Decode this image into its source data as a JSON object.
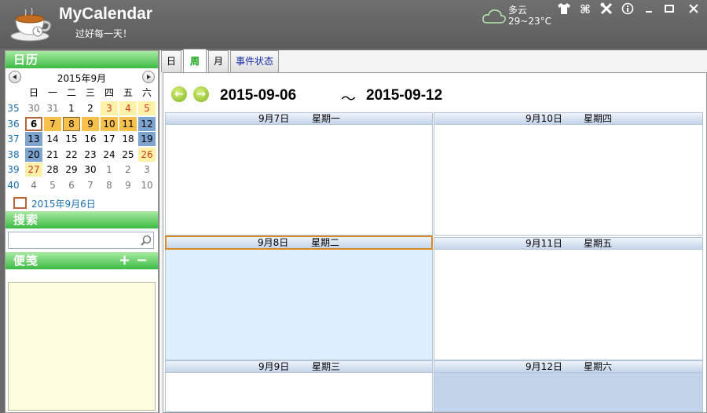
{
  "app": {
    "title": "MyCalendar",
    "subtitle": "过好每一天！",
    "weather": {
      "desc": "多云",
      "temp": "29~23°C"
    }
  },
  "toolbar": {
    "icons": [
      "shirt-icon",
      "command-icon",
      "tools-icon",
      "info-icon",
      "minimize-icon",
      "maximize-icon",
      "close-icon"
    ]
  },
  "calendar": {
    "header": "日历",
    "month_label": "2015年9月",
    "dow": [
      "日",
      "一",
      "二",
      "三",
      "四",
      "五",
      "六"
    ],
    "weeks": [
      "35",
      "36",
      "37",
      "38",
      "39",
      "40"
    ],
    "days": [
      [
        "30",
        "31",
        "1",
        "2",
        "3",
        "4",
        "5"
      ],
      [
        "6",
        "7",
        "8",
        "9",
        "10",
        "11",
        "12"
      ],
      [
        "13",
        "14",
        "15",
        "16",
        "17",
        "18",
        "19"
      ],
      [
        "20",
        "21",
        "22",
        "23",
        "24",
        "25",
        "26"
      ],
      [
        "27",
        "28",
        "29",
        "30",
        "1",
        "2",
        "3"
      ],
      [
        "4",
        "5",
        "6",
        "7",
        "8",
        "9",
        "10"
      ]
    ],
    "today_text": "2015年9月6日"
  },
  "search": {
    "header": "搜索",
    "placeholder": ""
  },
  "memo": {
    "header": "便笺",
    "add": "+",
    "remove": "−"
  },
  "tabs": [
    "日",
    "周",
    "月",
    "事件状态"
  ],
  "week_view": {
    "start": "2015-09-06",
    "sep": "～",
    "end": "2015-09-12",
    "days": [
      {
        "date": "9月7日",
        "weekday": "星期一"
      },
      {
        "date": "9月8日",
        "weekday": "星期二"
      },
      {
        "date": "9月9日",
        "weekday": "星期三"
      },
      {
        "date": "9月10日",
        "weekday": "星期四"
      },
      {
        "date": "9月11日",
        "weekday": "星期五"
      },
      {
        "date": "9月12日",
        "weekday": "星期六"
      }
    ]
  },
  "colors": {
    "green_header": "#3cbb44",
    "week_highlight": "#f7c04a",
    "weekend_highlight": "#7da3cf",
    "selected_day_bg": "#ddeeff",
    "saturday_bg": "#c3d4ea"
  }
}
